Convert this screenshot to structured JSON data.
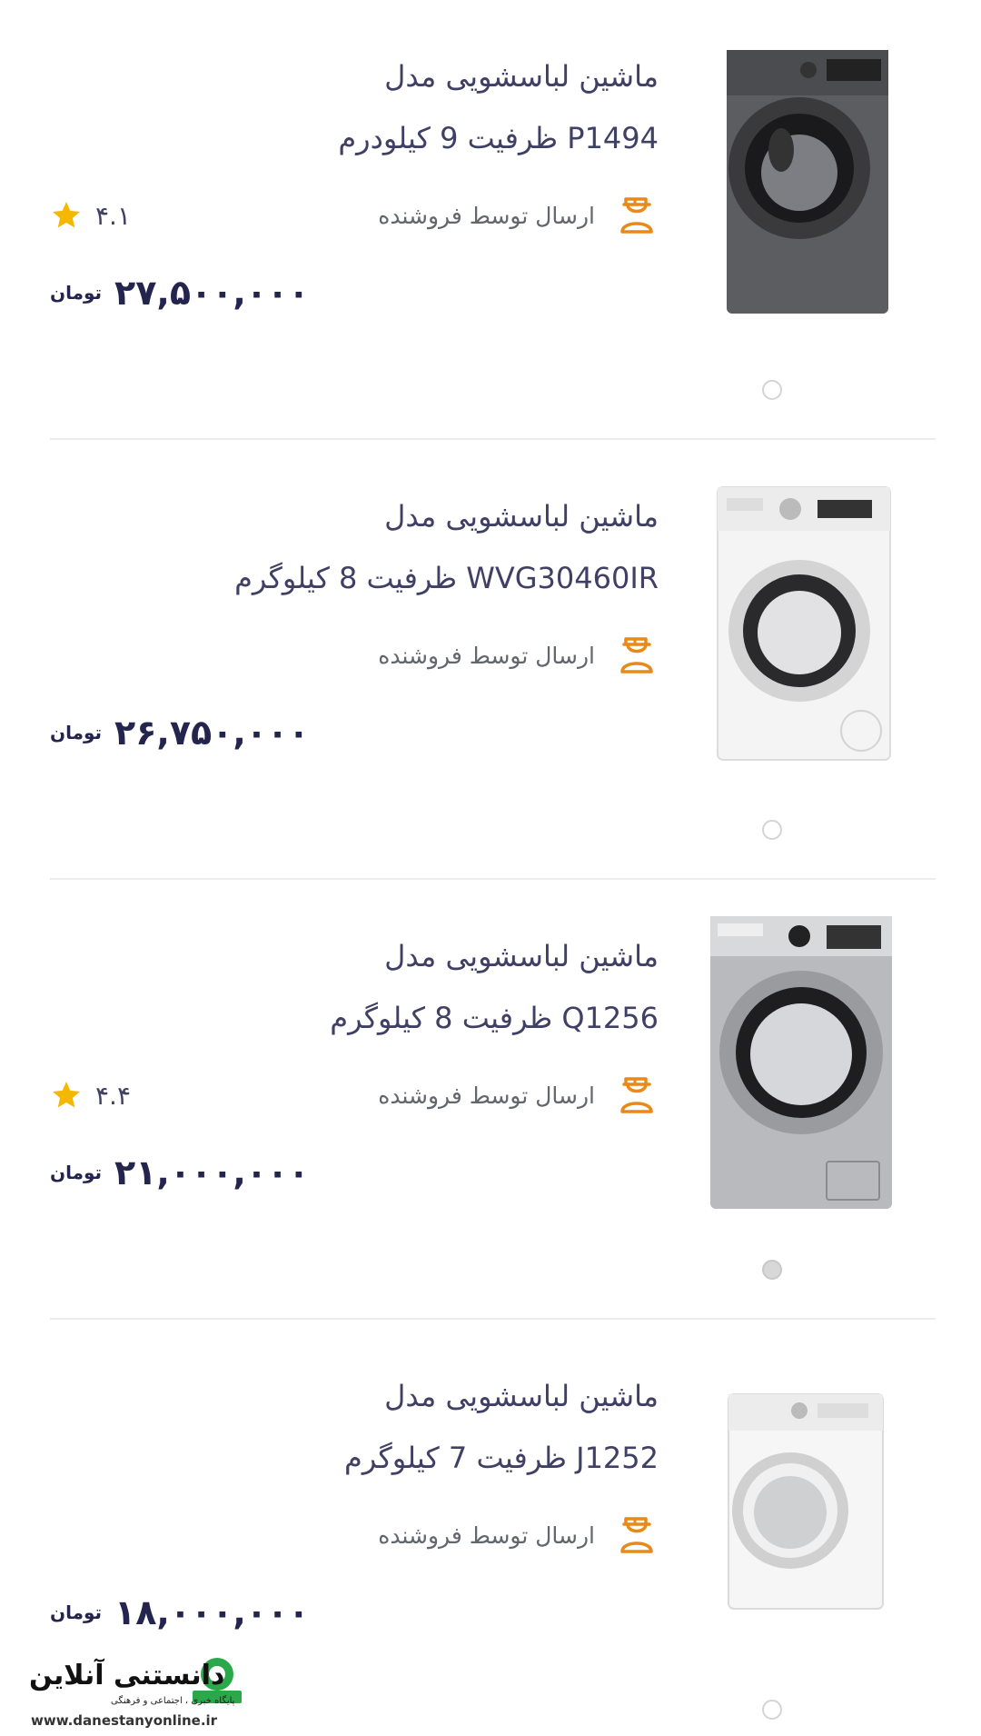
{
  "products": [
    {
      "title_line1": "ماشین لباسشویی          مدل",
      "title_line2": "P1494 ظرفیت 9 کیلودرم",
      "shipping": "ارسال توسط فروشنده",
      "rating": "۴.۱",
      "price": "۲۷,۵۰۰,۰۰۰",
      "currency": "تومان",
      "image_icon": "washing-machine-dark",
      "dot_active": false
    },
    {
      "title_line1": "ماشین لباسشویی     مدل",
      "title_line2": "WVG30460IR ظرفیت 8 کیلوگرم",
      "shipping": "ارسال توسط فروشنده",
      "rating": "",
      "price": "۲۶,۷۵۰,۰۰۰",
      "currency": "تومان",
      "image_icon": "washing-machine-white",
      "dot_active": false
    },
    {
      "title_line1": "ماشین لباسشویی          مدل",
      "title_line2": "Q1256 ظرفیت 8 کیلوگرم",
      "shipping": "ارسال توسط فروشنده",
      "rating": "۴.۴",
      "price": "۲۱,۰۰۰,۰۰۰",
      "currency": "تومان",
      "image_icon": "washing-machine-silver",
      "dot_active": true
    },
    {
      "title_line1": "ماشین لباسشویی          مدل",
      "title_line2": "J1252 ظرفیت 7 کیلوگرم",
      "shipping": "ارسال توسط فروشنده",
      "rating": "",
      "price": "۱۸,۰۰۰,۰۰۰",
      "currency": "تومان",
      "image_icon": "washing-machine-white",
      "dot_active": false
    }
  ],
  "colors": {
    "accent_orange": "#e8891a",
    "star_yellow": "#f5b800",
    "text_dark": "#23254e",
    "divider": "#ececec"
  },
  "watermark": {
    "name": "دانستنی آنلاین",
    "subtitle": "پایگاه خبری ، اجتماعی و فرهنگی",
    "site": "www.danestanyonline.ir"
  }
}
